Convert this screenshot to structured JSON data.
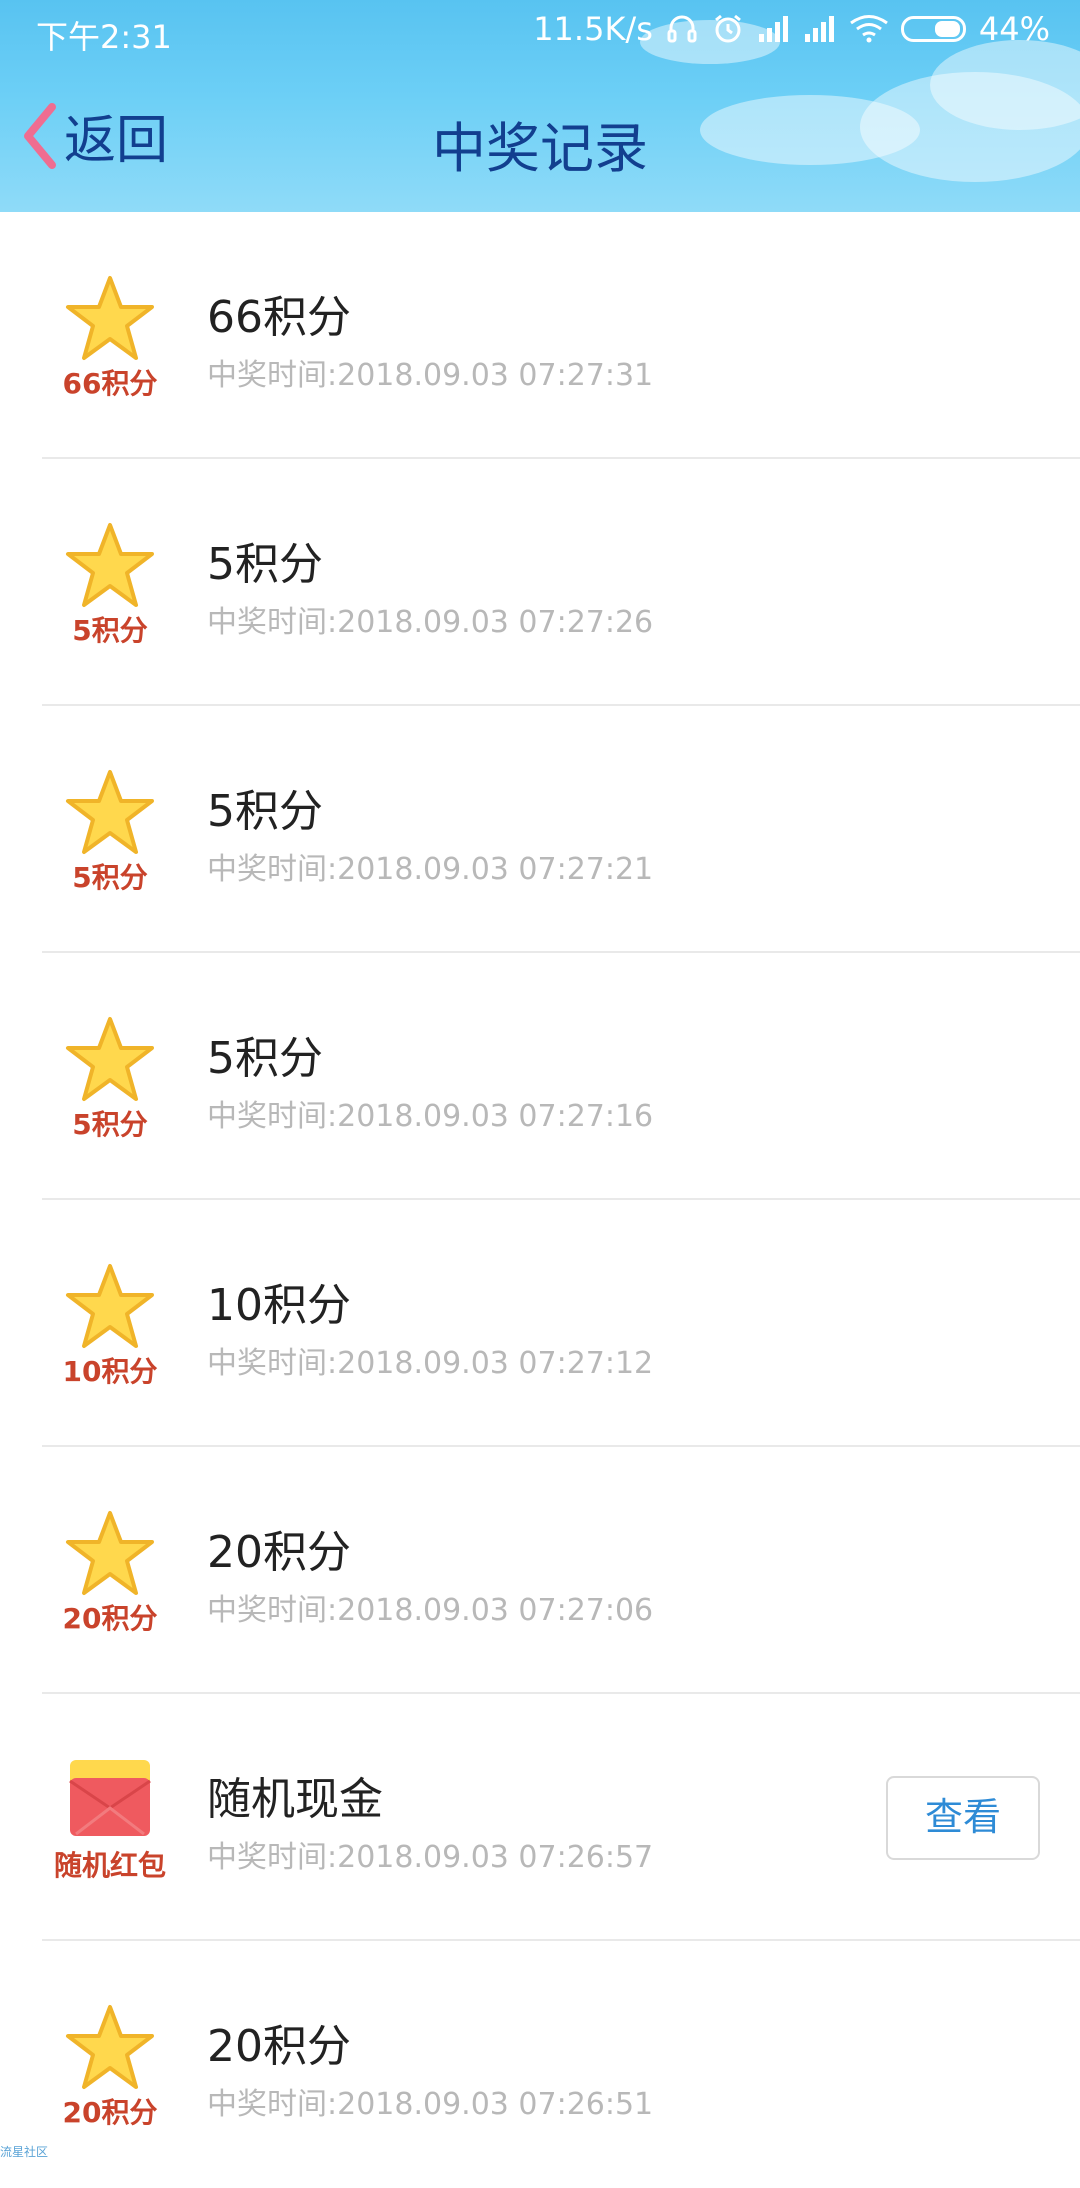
{
  "status_bar": {
    "time": "下午2:31",
    "network_speed": "11.5K/s",
    "battery": "44%"
  },
  "nav": {
    "back_label": "返回",
    "title": "中奖记录"
  },
  "records": [
    {
      "icon": "star-icon",
      "badge": "66积分",
      "title": "66积分",
      "time": "中奖时间:2018.09.03 07:27:31"
    },
    {
      "icon": "star-icon",
      "badge": "5积分",
      "title": "5积分",
      "time": "中奖时间:2018.09.03 07:27:26"
    },
    {
      "icon": "star-icon",
      "badge": "5积分",
      "title": "5积分",
      "time": "中奖时间:2018.09.03 07:27:21"
    },
    {
      "icon": "star-icon",
      "badge": "5积分",
      "title": "5积分",
      "time": "中奖时间:2018.09.03 07:27:16"
    },
    {
      "icon": "star-icon",
      "badge": "10积分",
      "title": "10积分",
      "time": "中奖时间:2018.09.03 07:27:12"
    },
    {
      "icon": "star-icon",
      "badge": "20积分",
      "title": "20积分",
      "time": "中奖时间:2018.09.03 07:27:06"
    },
    {
      "icon": "red-envelope-icon",
      "badge": "随机红包",
      "title": "随机现金",
      "time": "中奖时间:2018.09.03 07:26:57",
      "action": "查看"
    },
    {
      "icon": "star-icon",
      "badge": "20积分",
      "title": "20积分",
      "time": "中奖时间:2018.09.03 07:26:51"
    }
  ],
  "watermark": "流星社区",
  "colors": {
    "header_blue": "#6ccff6",
    "nav_text": "#123f8f",
    "back_chevron": "#ef6d91",
    "star_fill": "#ffd84d",
    "star_stroke": "#f0b429",
    "badge_text": "#c9432b",
    "envelope_red": "#ef5a5f",
    "envelope_yellow": "#ffd84d",
    "link_blue": "#2e8bd6"
  }
}
